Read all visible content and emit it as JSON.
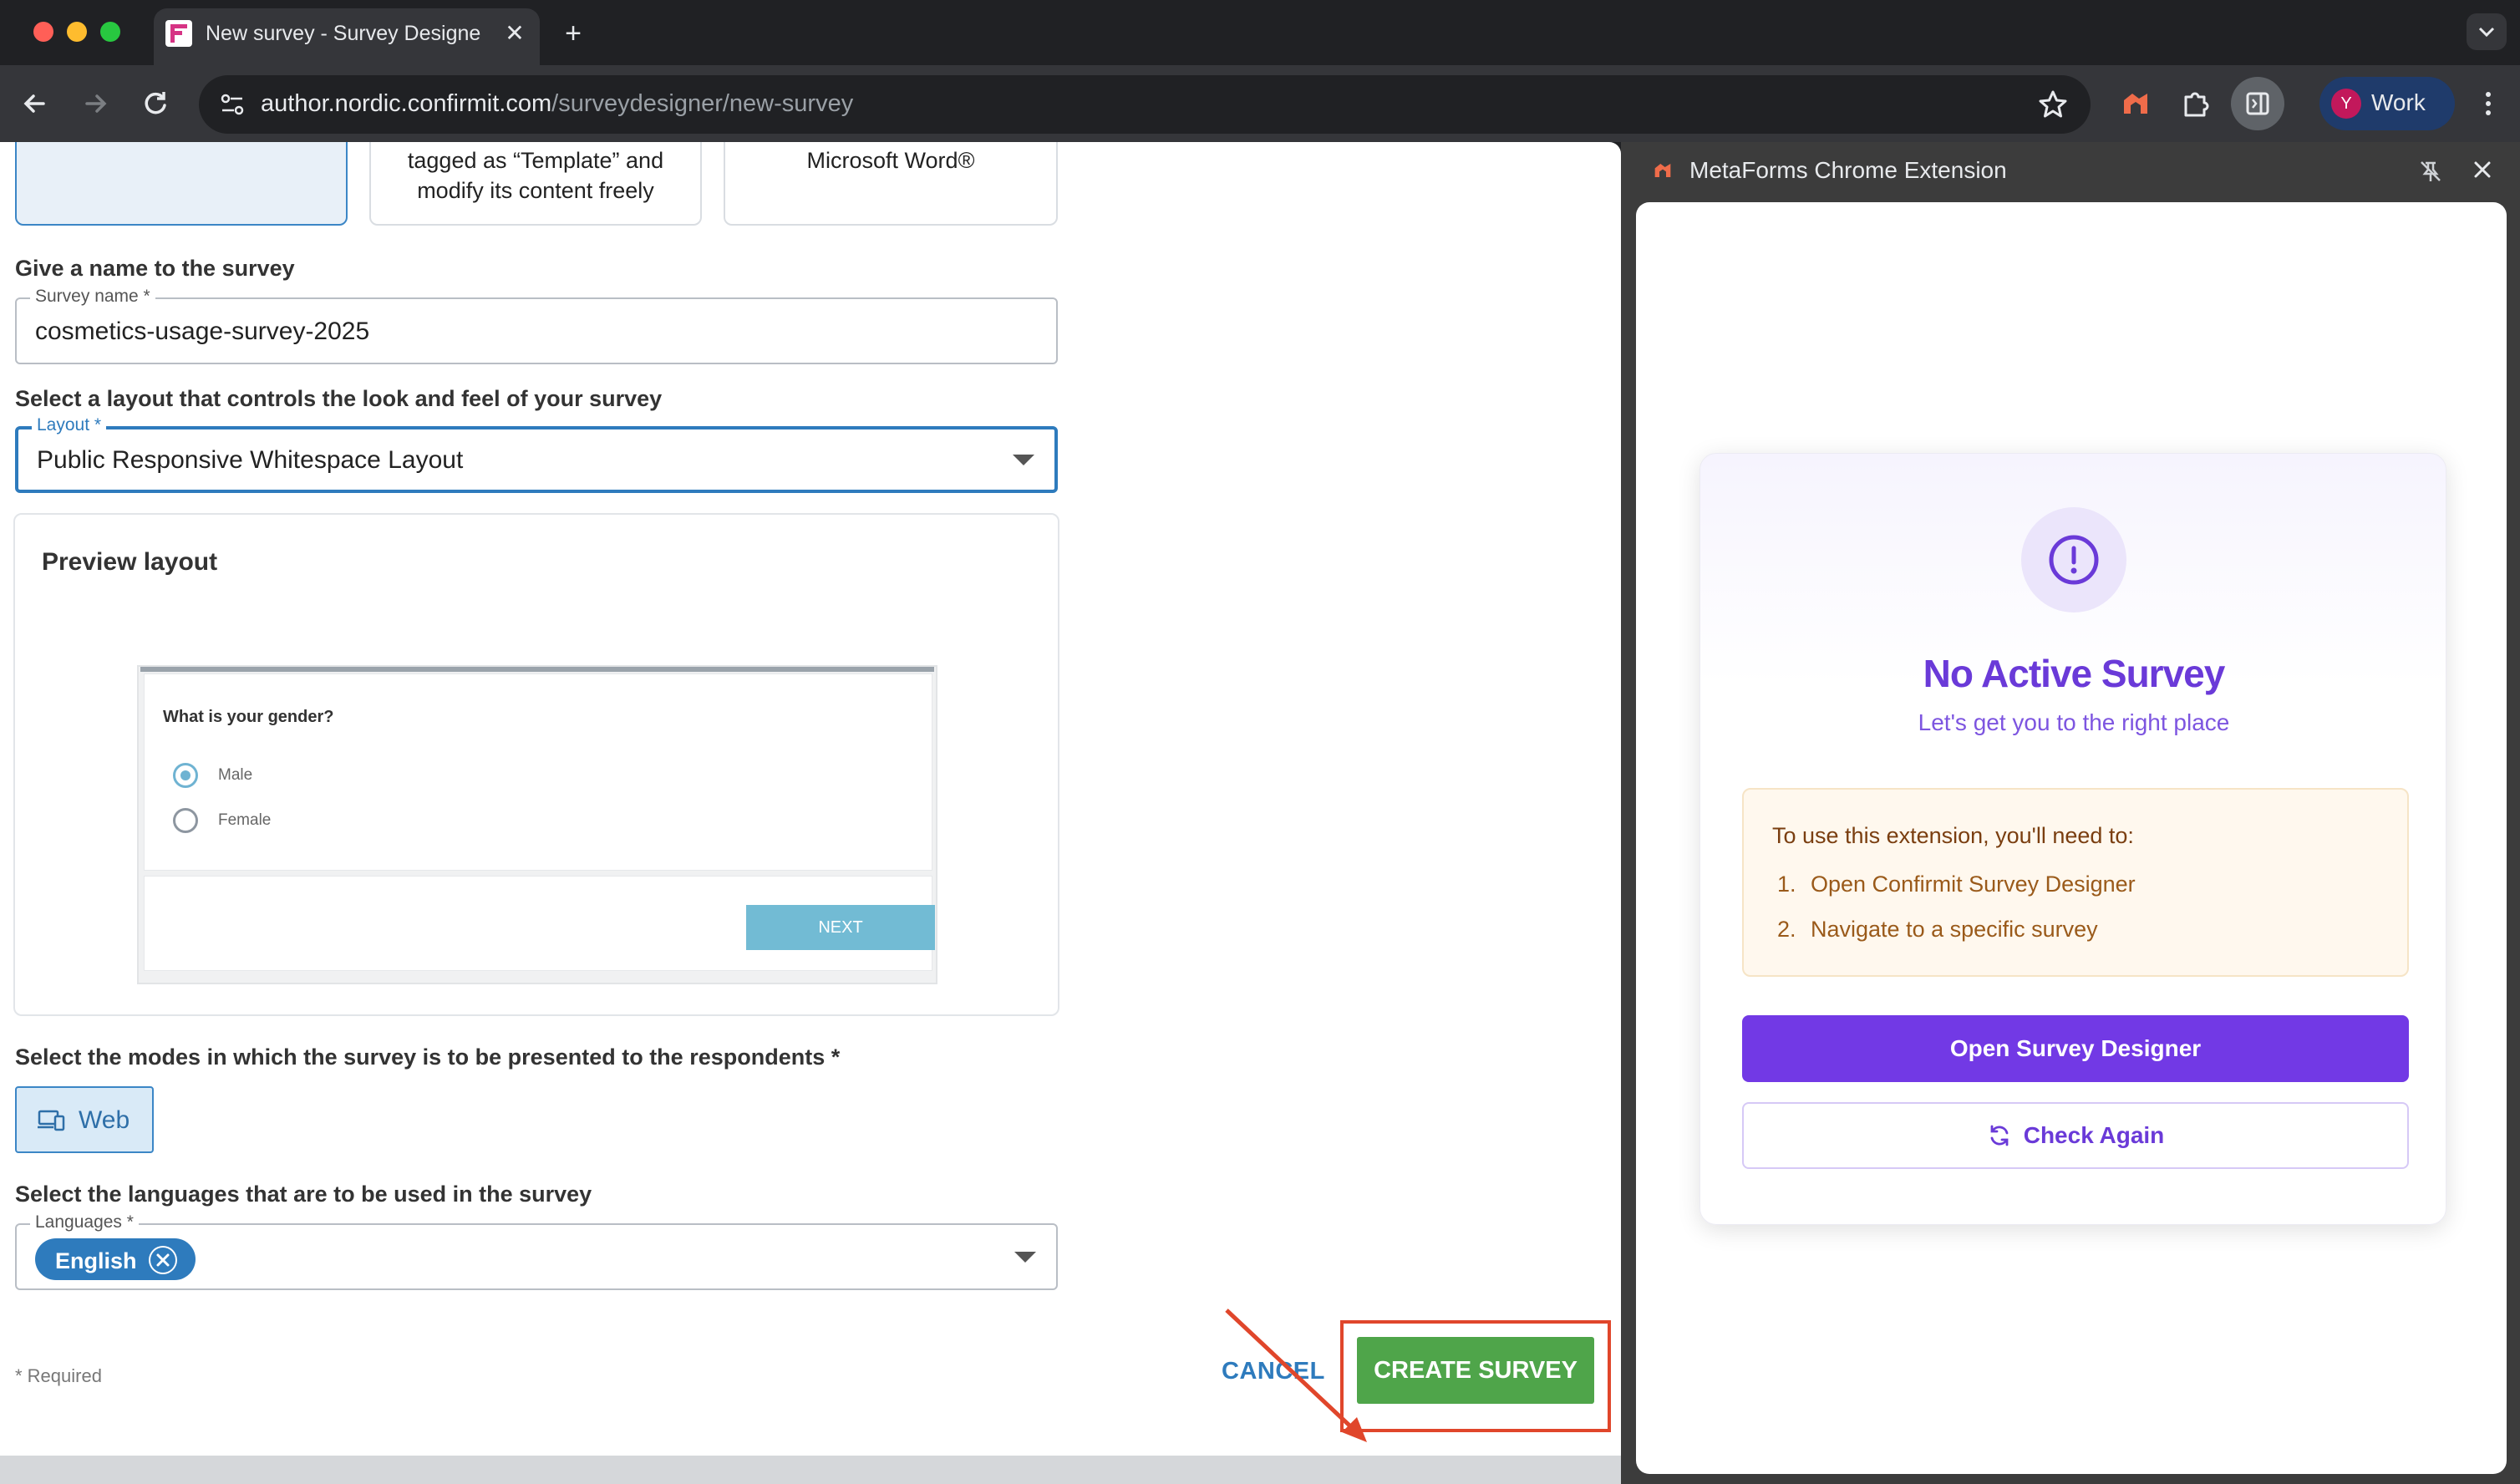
{
  "browser": {
    "tab_title": "New survey - Survey Designer",
    "tab_close": "✕",
    "new_tab": "+",
    "url_host": "author.nordic.confirmit.com",
    "url_path": "/surveydesigner/new-survey",
    "profile_initial": "Y",
    "profile_label": "Work"
  },
  "page": {
    "template_cards": [
      {
        "line1": "",
        "line2": ""
      },
      {
        "line1": "tagged as “Template” and",
        "line2": "modify its content freely"
      },
      {
        "line1": "Microsoft Word®",
        "line2": ""
      }
    ],
    "name_section_label": "Give a name to the survey",
    "survey_name": {
      "label": "Survey name *",
      "value": "cosmetics-usage-survey-2025"
    },
    "layout_section_label": "Select a layout that controls the look and feel of your survey",
    "layout": {
      "label": "Layout *",
      "value": "Public Responsive Whitespace Layout"
    },
    "preview": {
      "title": "Preview layout",
      "question": "What is your gender?",
      "options": [
        "Male",
        "Female"
      ],
      "selected_option": "Male",
      "next_label": "NEXT"
    },
    "modes_section_label": "Select the modes in which the survey is to be presented to the respondents *",
    "mode_web": "Web",
    "languages_section_label": "Select the languages that are to be used in the survey",
    "languages": {
      "label": "Languages *",
      "chips": [
        "English"
      ]
    },
    "required_note": "* Required",
    "cancel_label": "CANCEL",
    "create_label": "CREATE SURVEY"
  },
  "side_panel": {
    "title": "MetaForms Chrome Extension",
    "heading": "No Active Survey",
    "subheading": "Let's get you to the right place",
    "requirements_intro": "To use this extension, you'll need to:",
    "requirements": [
      {
        "num": "1.",
        "text": "Open Confirmit Survey Designer"
      },
      {
        "num": "2.",
        "text": "Navigate to a specific survey"
      }
    ],
    "primary_button": "Open Survey Designer",
    "secondary_button": "Check Again"
  },
  "colors": {
    "accent_blue": "#2e7bbd",
    "create_green": "#4fa54a",
    "annotation_red": "#e0462b",
    "extension_purple": "#7239e5"
  }
}
